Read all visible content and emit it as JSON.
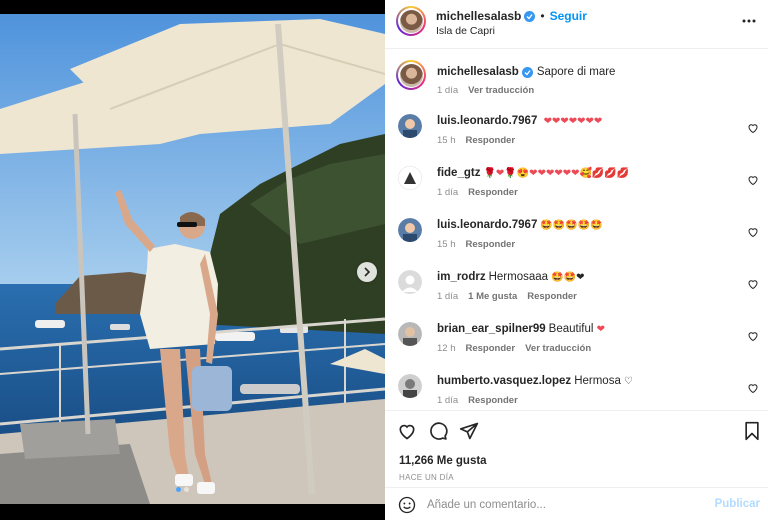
{
  "post": {
    "username": "michellesalasb",
    "follow_label": "Seguir",
    "location": "Isla de Capri",
    "caption": "Sapore di mare",
    "caption_time": "1 día",
    "caption_translate": "Ver traducción",
    "likes": "11,266 Me gusta",
    "posted": "HACE UN DÍA",
    "comment_placeholder": "Añade un comentario...",
    "publish_label": "Publicar"
  },
  "comments": [
    {
      "user": "luis.leonardo.7967",
      "text": "",
      "emoji": "❤❤❤❤❤❤❤",
      "time": "15 h",
      "reply": "Responder",
      "likes": "",
      "translate": ""
    },
    {
      "user": "fide_gtz",
      "text": "",
      "emoji": "🌹❤🌹😍❤❤❤❤❤❤🥰💋💋💋",
      "time": "1 día",
      "reply": "Responder",
      "likes": "",
      "translate": ""
    },
    {
      "user": "luis.leonardo.7967",
      "text": "",
      "emoji": "🤩🤩🤩🤩🤩",
      "time": "15 h",
      "reply": "Responder",
      "likes": "",
      "translate": ""
    },
    {
      "user": "im_rodrz",
      "text": "Hermosaaa",
      "emoji": "🤩🤩❤",
      "time": "1 día",
      "reply": "Responder",
      "likes": "1 Me gusta",
      "translate": ""
    },
    {
      "user": "brian_ear_spilner99",
      "text": "Beautiful",
      "emoji": "❤",
      "time": "12 h",
      "reply": "Responder",
      "likes": "",
      "translate": "Ver traducción"
    },
    {
      "user": "humberto.vasquez.lopez",
      "text": "Hermosa",
      "emoji": "♡",
      "time": "1 día",
      "reply": "Responder",
      "likes": "",
      "translate": ""
    }
  ],
  "colors": {
    "accent": "#0095f6",
    "heart": "#ed4956"
  },
  "icons": [
    "heart-icon",
    "comment-icon",
    "share-icon",
    "bookmark-icon",
    "smile-icon",
    "more-icon",
    "chevron-right-icon",
    "verified-icon"
  ]
}
